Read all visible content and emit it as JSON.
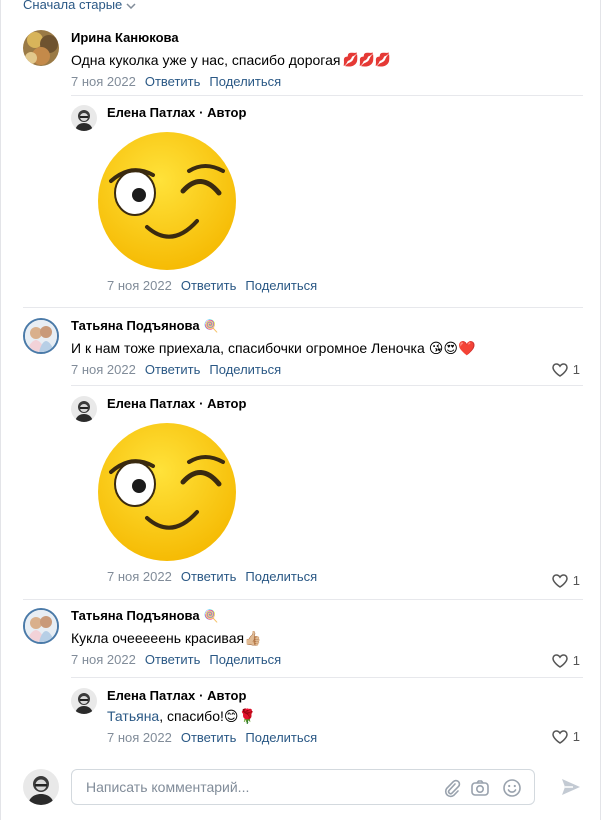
{
  "sort_label": "Сначала старые",
  "comments": [
    {
      "author": "Ирина Канюкова",
      "text": "Одна куколка уже у нас, спасибо дорогая",
      "emoji": "💋💋💋",
      "date": "7 ноя 2022",
      "reply": "Ответить",
      "share": "Поделиться"
    },
    {
      "author": "Елена Патлах",
      "role": "· Автор",
      "sticker": "wink-emoji",
      "date": "7 ноя 2022",
      "reply": "Ответить",
      "share": "Поделиться"
    },
    {
      "author": "Татьяна Подъянова",
      "badge": "🍭",
      "text": "И к нам тоже приехала, спасибочки огромное Леночка",
      "emoji": "😘😍❤️",
      "date": "7 ноя 2022",
      "reply": "Ответить",
      "share": "Поделиться",
      "likes": "1"
    },
    {
      "author": "Елена Патлах",
      "role": "· Автор",
      "sticker": "wink-emoji",
      "date": "7 ноя 2022",
      "reply": "Ответить",
      "share": "Поделиться",
      "likes": "1"
    },
    {
      "author": "Татьяна Подъянова",
      "badge": "🍭",
      "text": "Кукла очееееень красивая",
      "emoji": "👍🏼",
      "date": "7 ноя 2022",
      "reply": "Ответить",
      "share": "Поделиться",
      "likes": "1"
    },
    {
      "author": "Елена Патлах",
      "role": "· Автор",
      "mention": "Татьяна",
      "text": ", спасибо!",
      "emoji": "😊🌹",
      "date": "7 ноя 2022",
      "reply": "Ответить",
      "share": "Поделиться",
      "likes": "1"
    }
  ],
  "composer": {
    "placeholder": "Написать комментарий..."
  },
  "colors": {
    "link": "#2a5885",
    "muted": "#818c99",
    "divider": "#e7e8ec",
    "sticker_yellow": "#f7c21b"
  }
}
